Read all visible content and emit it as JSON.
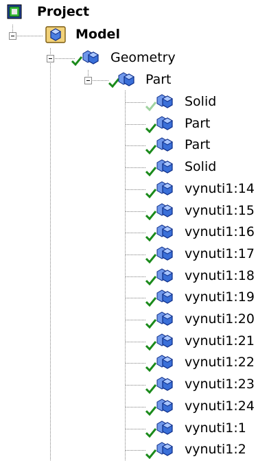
{
  "tree": {
    "root": {
      "label": "Project",
      "icon": "project-icon"
    },
    "model": {
      "label": "Model",
      "icon": "model-icon"
    },
    "geometry": {
      "label": "Geometry",
      "icon": "cube-stack-icon"
    },
    "part": {
      "label": "Part",
      "icon": "cube-stack-icon"
    },
    "children": [
      {
        "label": "Solid",
        "check": "light"
      },
      {
        "label": "Part",
        "check": "green"
      },
      {
        "label": "Part",
        "check": "green"
      },
      {
        "label": "Solid",
        "check": "green"
      },
      {
        "label": "vynuti1:14",
        "check": "green"
      },
      {
        "label": "vynuti1:15",
        "check": "green"
      },
      {
        "label": "vynuti1:16",
        "check": "green"
      },
      {
        "label": "vynuti1:17",
        "check": "green"
      },
      {
        "label": "vynuti1:18",
        "check": "green"
      },
      {
        "label": "vynuti1:19",
        "check": "green"
      },
      {
        "label": "vynuti1:20",
        "check": "green"
      },
      {
        "label": "vynuti1:21",
        "check": "green"
      },
      {
        "label": "vynuti1:22",
        "check": "green"
      },
      {
        "label": "vynuti1:23",
        "check": "green"
      },
      {
        "label": "vynuti1:24",
        "check": "green"
      },
      {
        "label": "vynuti1:1",
        "check": "green"
      },
      {
        "label": "vynuti1:2",
        "check": "green"
      }
    ]
  },
  "colors": {
    "check_green": "#1a8a1a",
    "check_light": "#9fd29f",
    "cube_blue": "#3a6fd8",
    "cube_light": "#a9c6ff",
    "folder_yellow": "#f2d27a"
  }
}
